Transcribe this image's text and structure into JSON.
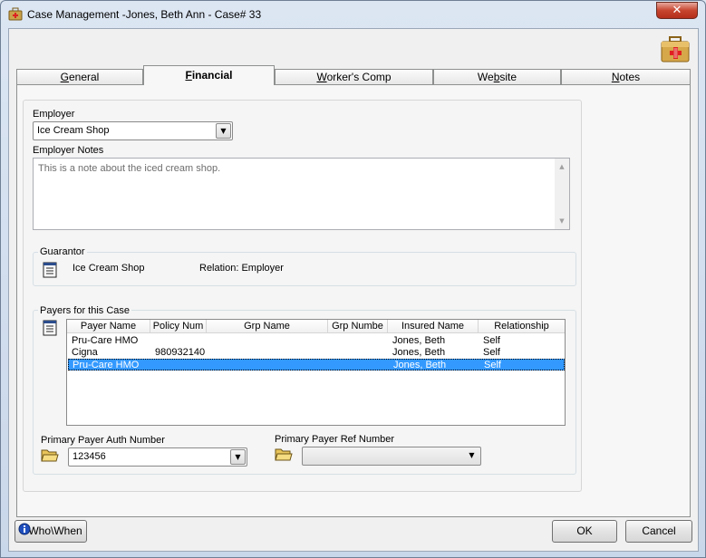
{
  "window": {
    "title": "Case Management -Jones, Beth Ann - Case#  33",
    "close_label": "✕"
  },
  "tabs": [
    {
      "label": "General",
      "underline_index": 0
    },
    {
      "label": "Financial",
      "underline_index": 0
    },
    {
      "label": "Worker's Comp",
      "underline_index": 0
    },
    {
      "label": "Website",
      "underline_index": 2
    },
    {
      "label": "Notes",
      "underline_index": 0
    }
  ],
  "active_tab": "Financial",
  "employer": {
    "label": "Employer",
    "selected": "Ice Cream Shop",
    "notes_label": "Employer Notes",
    "notes_text": "This is a note about the iced cream shop."
  },
  "guarantor": {
    "title": "Guarantor",
    "name": "Ice Cream Shop",
    "relation": "Relation: Employer"
  },
  "payers": {
    "title": "Payers for this Case",
    "columns": [
      "Payer Name",
      "Policy Num",
      "Grp Name",
      "Grp Numbe",
      "Insured Name",
      "Relationship"
    ],
    "rows": [
      [
        "Pru-Care HMO",
        "",
        "",
        "",
        "Jones, Beth",
        "Self"
      ],
      [
        "Cigna",
        "980932140",
        "",
        "",
        "Jones, Beth",
        "Self"
      ],
      [
        "Pru-Care HMO",
        "",
        "",
        "",
        "Jones, Beth",
        "Self"
      ]
    ],
    "selected_row": 2
  },
  "auth": {
    "label": "Primary Payer Auth Number",
    "value": "123456"
  },
  "ref": {
    "label": "Primary Payer Ref Number",
    "value": ""
  },
  "footer": {
    "whowhen_label": "Who\\When",
    "ok_label": "OK",
    "cancel_label": "Cancel"
  }
}
